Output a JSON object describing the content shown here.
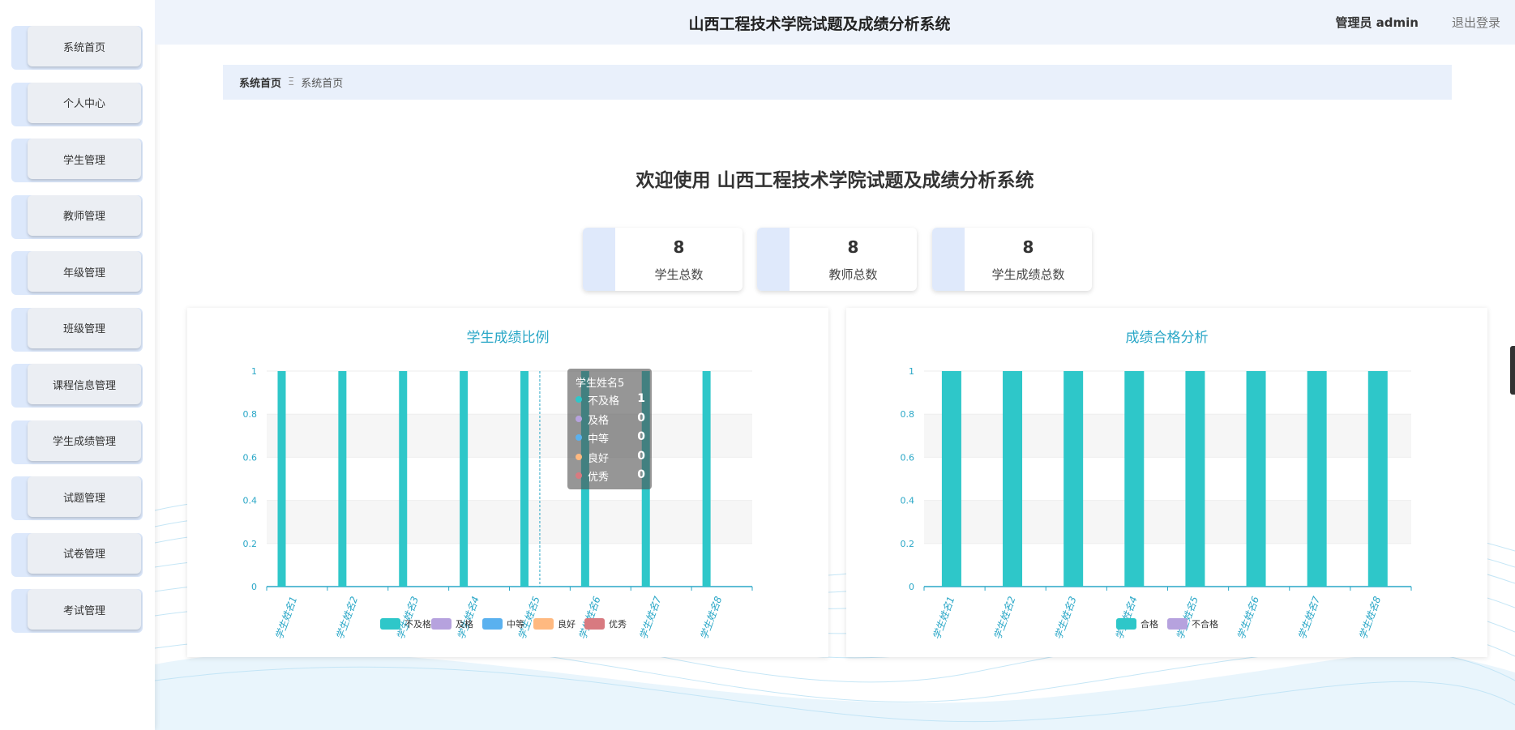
{
  "header": {
    "title": "山西工程技术学院试题及成绩分析系统",
    "user_label": "管理员 admin",
    "logout_label": "退出登录"
  },
  "sidebar": {
    "items": [
      {
        "label": "系统首页"
      },
      {
        "label": "个人中心"
      },
      {
        "label": "学生管理"
      },
      {
        "label": "教师管理"
      },
      {
        "label": "年级管理"
      },
      {
        "label": "班级管理"
      },
      {
        "label": "课程信息管理"
      },
      {
        "label": "学生成绩管理"
      },
      {
        "label": "试题管理"
      },
      {
        "label": "试卷管理"
      },
      {
        "label": "考试管理"
      }
    ]
  },
  "breadcrumb": {
    "first": "系统首页",
    "separator": "Ξ",
    "current": "系统首页"
  },
  "welcome": "欢迎使用 山西工程技术学院试题及成绩分析系统",
  "stats": [
    {
      "value": "8",
      "label": "学生总数"
    },
    {
      "value": "8",
      "label": "教师总数"
    },
    {
      "value": "8",
      "label": "学生成绩总数"
    }
  ],
  "colors": {
    "bar": "#2ec7c9",
    "accent": "#2aa7c7",
    "series": [
      "#2ec7c9",
      "#b6a2de",
      "#5ab1ef",
      "#ffb980",
      "#d87a80"
    ]
  },
  "tooltip": {
    "title": "学生姓名5",
    "rows": [
      {
        "name": "不及格",
        "value": "1"
      },
      {
        "name": "及格",
        "value": "0"
      },
      {
        "name": "中等",
        "value": "0"
      },
      {
        "name": "良好",
        "value": "0"
      },
      {
        "name": "优秀",
        "value": "0"
      }
    ]
  },
  "chart_data": [
    {
      "type": "bar",
      "title": "学生成绩比例",
      "categories": [
        "学生姓名1",
        "学生姓名2",
        "学生姓名3",
        "学生姓名4",
        "学生姓名5",
        "学生姓名6",
        "学生姓名7",
        "学生姓名8"
      ],
      "series": [
        {
          "name": "不及格",
          "values": [
            1,
            1,
            1,
            1,
            1,
            1,
            1,
            1
          ]
        },
        {
          "name": "及格",
          "values": [
            0,
            0,
            0,
            0,
            0,
            0,
            0,
            0
          ]
        },
        {
          "name": "中等",
          "values": [
            0,
            0,
            0,
            0,
            0,
            0,
            0,
            0
          ]
        },
        {
          "name": "良好",
          "values": [
            0,
            0,
            0,
            0,
            0,
            0,
            0,
            0
          ]
        },
        {
          "name": "优秀",
          "values": [
            0,
            0,
            0,
            0,
            0,
            0,
            0,
            0
          ]
        }
      ],
      "ylim": [
        0,
        1
      ],
      "yticks": [
        "0",
        "0.2",
        "0.4",
        "0.6",
        "0.8",
        "1"
      ],
      "legend": "bottom"
    },
    {
      "type": "bar",
      "title": "成绩合格分析",
      "categories": [
        "学生姓名1",
        "学生姓名2",
        "学生姓名3",
        "学生姓名4",
        "学生姓名5",
        "学生姓名6",
        "学生姓名7",
        "学生姓名8"
      ],
      "series": [
        {
          "name": "合格",
          "values": [
            1,
            1,
            1,
            1,
            1,
            1,
            1,
            1
          ]
        },
        {
          "name": "不合格",
          "values": [
            0,
            0,
            0,
            0,
            0,
            0,
            0,
            0
          ]
        }
      ],
      "ylim": [
        0,
        1
      ],
      "yticks": [
        "0",
        "0.2",
        "0.4",
        "0.6",
        "0.8",
        "1"
      ],
      "legend": "bottom"
    }
  ]
}
